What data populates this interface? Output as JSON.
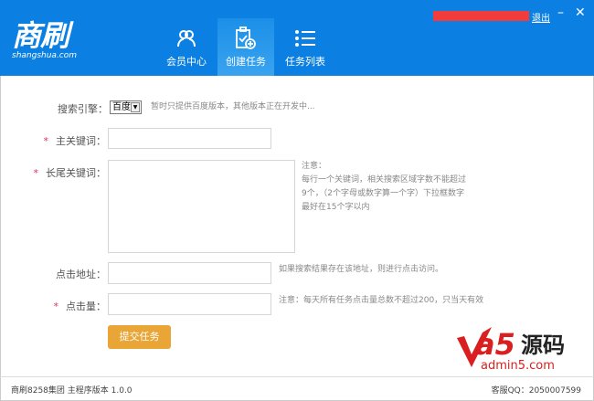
{
  "header": {
    "logo_text": "商刷",
    "logo_sub": "shangshua.com",
    "logout": "退出",
    "minimize": "–",
    "close": "✕",
    "tabs": [
      {
        "label": "会员中心",
        "icon": "users-icon"
      },
      {
        "label": "创建任务",
        "icon": "clipboard-add-icon",
        "active": true
      },
      {
        "label": "任务列表",
        "icon": "list-icon"
      }
    ]
  },
  "form": {
    "engine_label": "搜索引擎：",
    "engine_value": "百度",
    "engine_note": "暂时只提供百度版本，其他版本正在开发中...",
    "required_mark": "*",
    "main_kw_label": "主关键词：",
    "main_kw_value": "",
    "long_kw_label": "长尾关键词：",
    "long_kw_value": "",
    "long_kw_note": [
      "注意：",
      "每行一个关键词，相关搜索区域字数不能超过",
      "9个，（2个字母或数字算一个字）下拉框数字",
      "最好在15个字以内"
    ],
    "url_label": "点击地址：",
    "url_value": "",
    "url_note": "如果搜索结果存在该地址，则进行点击访问。",
    "clicks_label": "点击量：",
    "clicks_value": "",
    "clicks_note": "注意：每天所有任务点击量总数不超过200，只当天有效",
    "submit": "提交任务"
  },
  "watermark": {
    "text": "a5源码",
    "sub": "admin5.com"
  },
  "footer": {
    "left": "商刷8258集团 主程序版本 1.0.0",
    "right": "客服QQ：2050007599"
  }
}
